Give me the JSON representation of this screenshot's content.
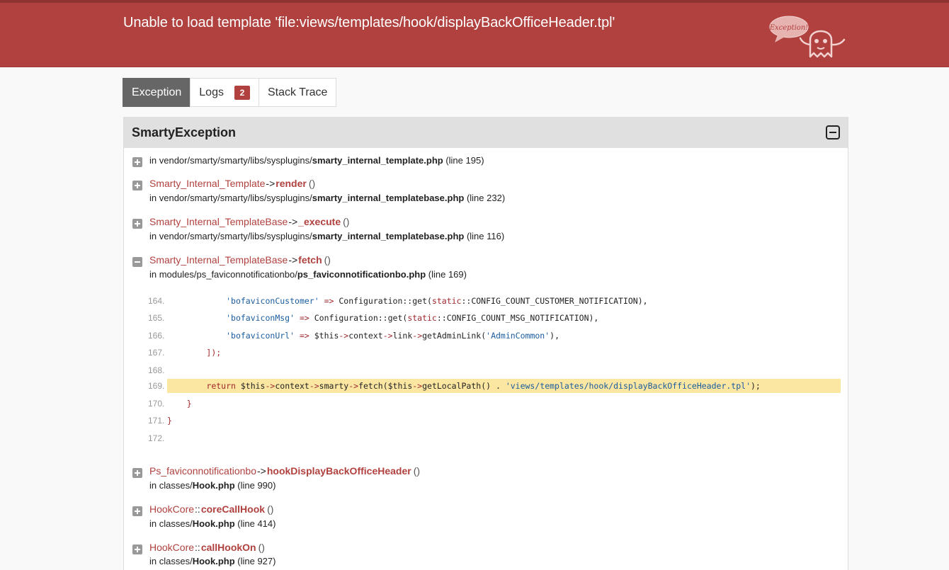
{
  "header": {
    "title": "Unable to load template 'file:views/templates/hook/displayBackOfficeHeader.tpl'",
    "mascot_text": "Exception!",
    "colors": {
      "bar": "#b0413e",
      "bar_border": "#8d3330"
    }
  },
  "tabs": [
    {
      "label": "Exception",
      "active": true
    },
    {
      "label": "Logs",
      "badge": "2",
      "active": false
    },
    {
      "label": "Stack Trace",
      "active": false
    }
  ],
  "panel": {
    "title": "SmartyException"
  },
  "frames": [
    {
      "expanded": false,
      "cls": "",
      "sep": "",
      "fn": "",
      "parens": "",
      "path": "in vendor/smarty/smarty/libs/sysplugins/",
      "file": "smarty_internal_template.php",
      "line": "(line 195)"
    },
    {
      "expanded": false,
      "cls": "Smarty_Internal_Template",
      "sep": "->",
      "fn": "render",
      "parens": "()",
      "path": "in vendor/smarty/smarty/libs/sysplugins/",
      "file": "smarty_internal_templatebase.php",
      "line": "(line 232)"
    },
    {
      "expanded": false,
      "cls": "Smarty_Internal_TemplateBase",
      "sep": "->",
      "fn": "_execute",
      "parens": "()",
      "path": "in vendor/smarty/smarty/libs/sysplugins/",
      "file": "smarty_internal_templatebase.php",
      "line": "(line 116)"
    },
    {
      "expanded": true,
      "cls": "Smarty_Internal_TemplateBase",
      "sep": "->",
      "fn": "fetch",
      "parens": "()",
      "path": "in modules/ps_faviconnotificationbo/",
      "file": "ps_faviconnotificationbo.php",
      "line": "(line 169)"
    },
    {
      "expanded": false,
      "cls": "Ps_faviconnotificationbo",
      "sep": "->",
      "fn": "hookDisplayBackOfficeHeader",
      "parens": "()",
      "path": "in classes/",
      "file": "Hook.php",
      "line": "(line 990)"
    },
    {
      "expanded": false,
      "cls": "HookCore",
      "sep": "::",
      "fn": "coreCallHook",
      "parens": "()",
      "path": "in classes/",
      "file": "Hook.php",
      "line": "(line 414)"
    },
    {
      "expanded": false,
      "cls": "HookCore",
      "sep": "::",
      "fn": "callHookOn",
      "parens": "()",
      "path": "in classes/",
      "file": "Hook.php",
      "line": "(line 927)"
    }
  ],
  "code": {
    "highlight_line": "169.",
    "lines": [
      {
        "num": "164.",
        "text": "            'bofaviconCustomer' => Configuration::get(static::CONFIG_COUNT_CUSTOMER_NOTIFICATION),"
      },
      {
        "num": "165.",
        "text": "            'bofaviconMsg' => Configuration::get(static::CONFIG_COUNT_MSG_NOTIFICATION),"
      },
      {
        "num": "166.",
        "text": "            'bofaviconUrl' => $this->context->link->getAdminLink('AdminCommon'),"
      },
      {
        "num": "167.",
        "text": "        ]);"
      },
      {
        "num": "168.",
        "text": ""
      },
      {
        "num": "169.",
        "text": "        return $this->context->smarty->fetch($this->getLocalPath() . 'views/templates/hook/displayBackOfficeHeader.tpl');"
      },
      {
        "num": "170.",
        "text": "    }"
      },
      {
        "num": "171.",
        "text": "}"
      },
      {
        "num": "172.",
        "text": ""
      }
    ]
  }
}
